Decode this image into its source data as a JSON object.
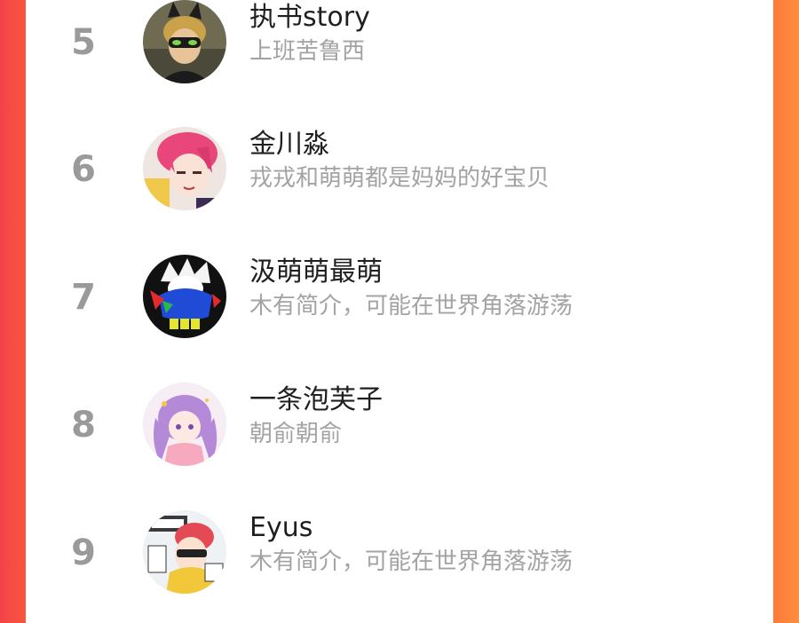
{
  "ranking": {
    "items": [
      {
        "rank": "5",
        "name": "执书story",
        "bio": "上班苦鲁西",
        "avatar_icon": "cat-mask-hero-avatar"
      },
      {
        "rank": "6",
        "name": "金川淼",
        "bio": "戎戎和萌萌都是妈妈的好宝贝",
        "avatar_icon": "pink-hair-anime-avatar"
      },
      {
        "rank": "7",
        "name": "汲萌萌最萌",
        "bio": "木有简介，可能在世界角落游荡",
        "avatar_icon": "white-hair-hoodie-avatar"
      },
      {
        "rank": "8",
        "name": "一条泡芙子",
        "bio": "朝俞朝俞",
        "avatar_icon": "purple-hair-girl-avatar"
      },
      {
        "rank": "9",
        "name": "Eyus",
        "bio": "木有简介，可能在世界角落游荡",
        "avatar_icon": "manga-boy-avatar"
      }
    ]
  },
  "colors": {
    "background_left": "#f5424a",
    "background_right": "#ff8d3f",
    "card": "#ffffff",
    "rank_text": "#9a9a9a",
    "name_text": "#1f1f1f",
    "bio_text": "#a3a3a3"
  }
}
